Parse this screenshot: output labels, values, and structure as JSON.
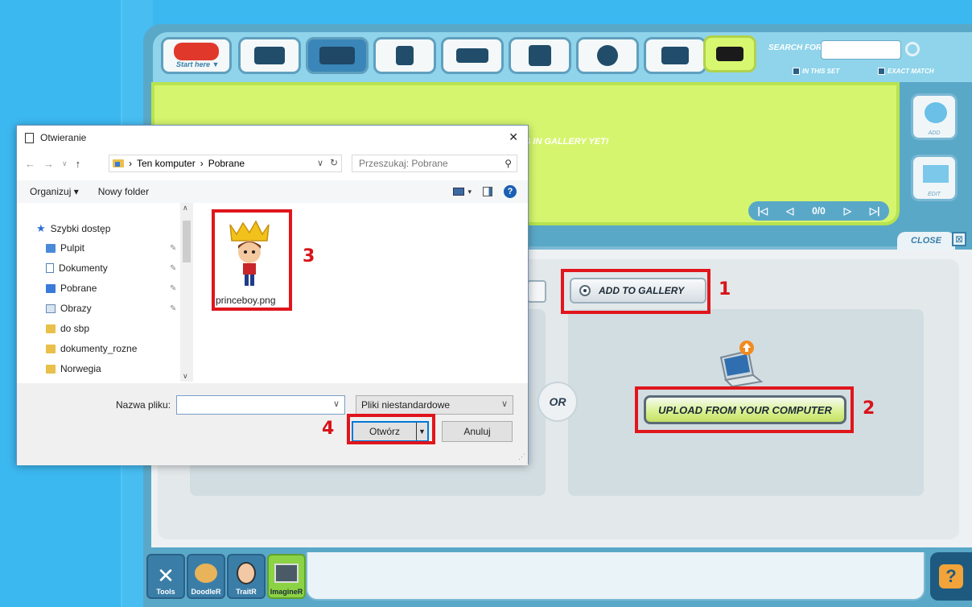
{
  "toolbar": {
    "start_label": "Start here ▼",
    "search_label": "SEARCH FOR",
    "search_value": "",
    "in_this_set": "IN THIS SET",
    "exact_match": "EXACT MATCH"
  },
  "gallery": {
    "message": "S IN GALLERY YET!",
    "pager": "0/0",
    "add_label": "ADD",
    "edit_label": "EDIT"
  },
  "panel": {
    "close_label": "CLOSE",
    "add_to_gallery": "ADD TO GALLERY",
    "or_label": "OR",
    "upload_label": "UPLOAD FROM YOUR COMPUTER"
  },
  "annotations": {
    "n1": "1",
    "n2": "2",
    "n3": "3",
    "n4": "4",
    "color": "#e0161c"
  },
  "dock": {
    "items": [
      {
        "label": "Tools"
      },
      {
        "label": "DoodleR"
      },
      {
        "label": "TraitR"
      },
      {
        "label": "ImagineR"
      }
    ]
  },
  "dialog": {
    "title": "Otwieranie",
    "path_root": "Ten komputer",
    "path_leaf": "Pobrane",
    "search_placeholder": "Przeszukaj: Pobrane",
    "organize": "Organizuj ▾",
    "new_folder": "Nowy folder",
    "tree": [
      {
        "label": "Szybki dostęp"
      },
      {
        "label": "Pulpit"
      },
      {
        "label": "Dokumenty"
      },
      {
        "label": "Pobrane"
      },
      {
        "label": "Obrazy"
      },
      {
        "label": "do sbp"
      },
      {
        "label": "dokumenty_rozne"
      },
      {
        "label": "Norwegia"
      }
    ],
    "file_name": "princeboy.png",
    "filename_label": "Nazwa pliku:",
    "filename_value": "",
    "filter_label": "Pliki niestandardowe",
    "open_label": "Otwórz",
    "cancel_label": "Anuluj"
  }
}
